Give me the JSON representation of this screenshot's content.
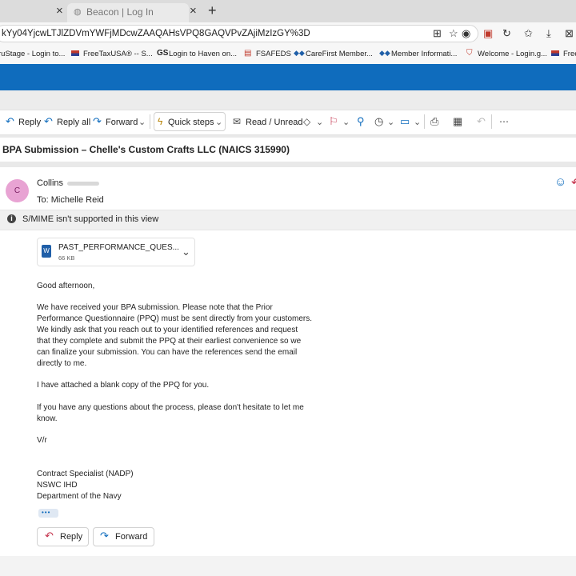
{
  "browser": {
    "tab_close_1": "×",
    "tab_title": "Beacon | Log In",
    "tab_close_2": "×",
    "new_tab": "+",
    "url": "kYy04YjcwLTJlZDVmYWFjMDcwZAAQAHsVPQ8GAQVPvZAjiMzIzGY%3D",
    "favorites": [
      "ruStage - Login to...",
      "FreeTaxUSA® -- S...",
      "Login to Haven on...",
      "FSAFEDS",
      "CareFirst Member...",
      "Member Informati...",
      "Welcome - Login.g...",
      "Free"
    ]
  },
  "toolbar": {
    "reply": "Reply",
    "reply_all": "Reply all",
    "forward": "Forward",
    "quick_steps": "Quick steps",
    "read_unread": "Read / Unread"
  },
  "message": {
    "subject": "BPA Submission – Chelle's Custom Crafts LLC (NAICS 315990)",
    "avatar_initial": "C",
    "sender": "Collins",
    "to": "To:  Michelle Reid",
    "smime_notice": "S/MIME isn't supported in this view",
    "attachment": {
      "name": "PAST_PERFORMANCE_QUES...",
      "size": "66 KB"
    },
    "body": [
      "Good afternoon,",
      "We have received your BPA submission.  Please note that the Prior",
      "Performance Questionnaire (PPQ) must be sent directly from your customers.",
      "We kindly ask that you reach out to your identified references and request",
      "that they complete and submit the PPQ at their earliest convenience so we",
      "can finalize your submission.  You can have the references send the email",
      "directly to me.",
      "I have attached a blank copy of the PPQ for you.",
      "If you have any questions about the process, please don't hesitate to let me",
      "know.",
      "V/r",
      "Contract Specialist (NADP)",
      "NSWC IHD",
      "Department of the Navy"
    ],
    "more": "•••",
    "reply_button": "Reply",
    "forward_button": "Forward"
  },
  "colors": {
    "accent": "#0f6cbd",
    "avatar": "#e8a3d3"
  }
}
